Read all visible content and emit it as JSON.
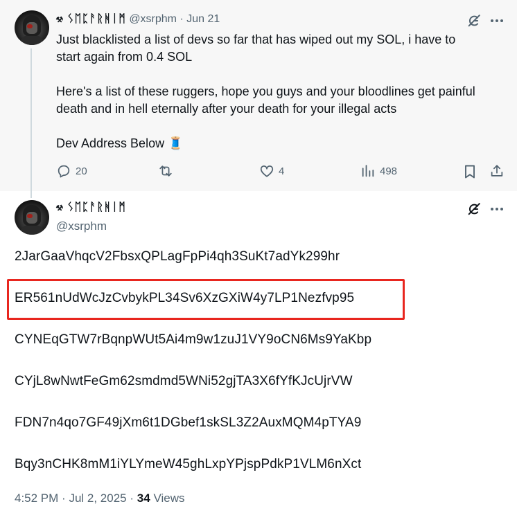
{
  "parent_tweet": {
    "author_name": "⚒ ᛊᛖᛈᚨᚱᚻᛁᛗ",
    "handle": "@xsrphm",
    "separator": "·",
    "date": "Jun 21",
    "text_lines": [
      "Just blacklisted a list of devs so far that has wiped out my SOL, i have to",
      "start again from 0.4 SOL",
      "Here's a list of these ruggers, hope you guys and your bloodlines get painful",
      "death and in hell eternally after your death for your illegal acts",
      "Dev Address Below"
    ],
    "emoji": "🧵",
    "stats": {
      "replies": "20",
      "likes": "4",
      "views": "498"
    }
  },
  "main_tweet": {
    "author_name": "⚒ ᛊᛖᛈᚨᚱᚻᛁᛗ",
    "handle": "@xsrphm",
    "addresses": [
      "2JarGaaVhqcV2FbsxQPLagFpPi4qh3SuKt7adYk299hr",
      "ER561nUdWcJzCvbykPL34Sv6XzGXiW4y7LP1Nezfvp95",
      "CYNEqGTW7rBqnpWUt5Ai4m9w1zuJ1VY9oCN6Ms9YaKbp",
      "CYjL8wNwtFeGm62smdmd5WNi52gjTA3X6fYfKJcUjrVW",
      "FDN7n4qo7GF49jXm6t1DGbef1skSL3Z2AuxMQM4pTYA9",
      "Bqy3nCHK8mM1iYLYmeW45ghLxpYPjspPdkP1VLM6nXct"
    ],
    "footer": {
      "time": "4:52 PM",
      "date": "Jul 2, 2025",
      "views_count": "34",
      "views_label": "Views",
      "separator": "·"
    }
  },
  "icons": [
    "grok-icon",
    "more-icon",
    "reply-icon",
    "retweet-icon",
    "like-icon",
    "views-icon",
    "bookmark-icon",
    "share-icon"
  ],
  "colors": {
    "highlight": "#e8261f",
    "muted": "#536471",
    "text": "#0f1419",
    "parent_bg": "#f7f7f7"
  }
}
